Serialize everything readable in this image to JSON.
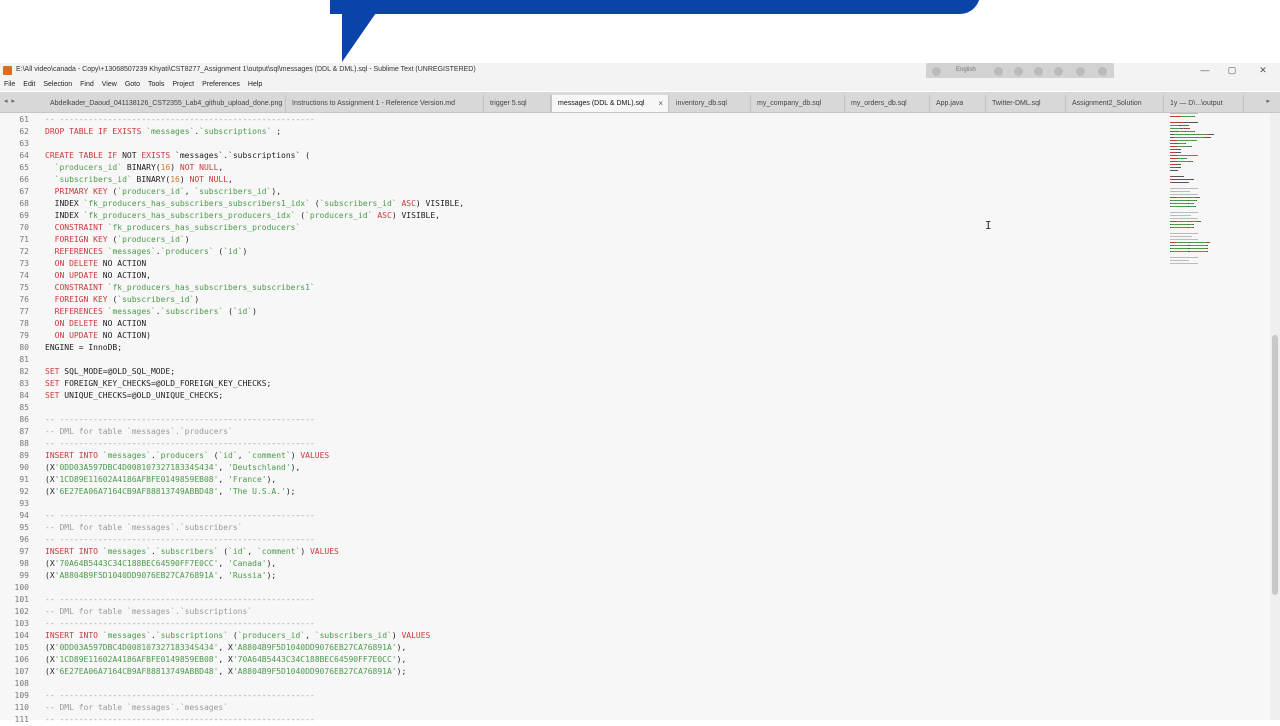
{
  "window": {
    "title": "E:\\All video\\canada - Copy\\+13068507239 Khyati\\CST8277_Assignment 1\\output\\sql\\messages (DDL & DML).sql - Sublime Text (UNREGISTERED)",
    "overlay_language": "English",
    "controls": {
      "minimize": "—",
      "maximize": "▢",
      "close": "✕"
    }
  },
  "menu": [
    "File",
    "Edit",
    "Selection",
    "Find",
    "View",
    "Goto",
    "Tools",
    "Project",
    "Preferences",
    "Help"
  ],
  "tabs": {
    "nav": "◂ ▸",
    "overflow": "▸",
    "close_glyph": "×",
    "items": [
      {
        "label": "Abdelkader_Daoud_041138126_CST2355_Lab4_github_upload_done.png",
        "active": false
      },
      {
        "label": "Instructions to Assignment 1 - Reference Version.md",
        "active": false
      },
      {
        "label": "trigger 5.sql",
        "active": false
      },
      {
        "label": "messages (DDL & DML).sql",
        "active": true
      },
      {
        "label": "inventory_db.sql",
        "active": false
      },
      {
        "label": "my_company_db.sql",
        "active": false
      },
      {
        "label": "my_orders_db.sql",
        "active": false
      },
      {
        "label": "App.java",
        "active": false
      },
      {
        "label": "Twitter-DML.sql",
        "active": false
      },
      {
        "label": "Assignment2_Solution",
        "active": false
      },
      {
        "label": "1y — D\\...\\output",
        "active": false
      }
    ]
  },
  "editor": {
    "lines": [
      {
        "n": "61",
        "t": [
          [
            "cm",
            "-- -----------------------------------------------------"
          ]
        ]
      },
      {
        "n": "62",
        "t": [
          [
            "kw",
            "DROP TABLE IF EXISTS "
          ],
          [
            "str",
            "`messages`"
          ],
          [
            "tk",
            "."
          ],
          [
            "str",
            "`subscriptions`"
          ],
          [
            "tk",
            " ;"
          ]
        ]
      },
      {
        "n": "63",
        "t": []
      },
      {
        "n": "64",
        "t": [
          [
            "kw",
            "CREATE TABLE IF "
          ],
          [
            "tk",
            "NOT "
          ],
          [
            "kw",
            "EXISTS "
          ],
          [
            "tk",
            "`messages`.`subscriptions` ("
          ]
        ]
      },
      {
        "n": "65",
        "t": [
          [
            "str",
            "  `producers_id` "
          ],
          [
            "tk",
            "BINARY("
          ],
          [
            "num",
            "16"
          ],
          [
            "tk",
            ") "
          ],
          [
            "kw",
            "NOT NULL"
          ],
          [
            "tk",
            ","
          ]
        ]
      },
      {
        "n": "66",
        "t": [
          [
            "str",
            "  `subscribers_id` "
          ],
          [
            "tk",
            "BINARY("
          ],
          [
            "num",
            "16"
          ],
          [
            "tk",
            ") "
          ],
          [
            "kw",
            "NOT NULL"
          ],
          [
            "tk",
            ","
          ]
        ]
      },
      {
        "n": "67",
        "t": [
          [
            "kw",
            "  PRIMARY KEY "
          ],
          [
            "tk",
            "("
          ],
          [
            "str",
            "`producers_id`"
          ],
          [
            "tk",
            ", "
          ],
          [
            "str",
            "`subscribers_id`"
          ],
          [
            "tk",
            "),"
          ]
        ]
      },
      {
        "n": "68",
        "t": [
          [
            "tk",
            "  INDEX "
          ],
          [
            "str",
            "`fk_producers_has_subscribers_subscribers1_idx`"
          ],
          [
            "tk",
            " ("
          ],
          [
            "str",
            "`subscribers_id`"
          ],
          [
            "tk",
            " "
          ],
          [
            "kw",
            "ASC"
          ],
          [
            "tk",
            ") VISIBLE,"
          ]
        ]
      },
      {
        "n": "69",
        "t": [
          [
            "tk",
            "  INDEX "
          ],
          [
            "str",
            "`fk_producers_has_subscribers_producers_idx`"
          ],
          [
            "tk",
            " ("
          ],
          [
            "str",
            "`producers_id`"
          ],
          [
            "tk",
            " "
          ],
          [
            "kw",
            "ASC"
          ],
          [
            "tk",
            ") VISIBLE,"
          ]
        ]
      },
      {
        "n": "70",
        "t": [
          [
            "kw",
            "  CONSTRAINT "
          ],
          [
            "str",
            "`fk_producers_has_subscribers_producers`"
          ]
        ]
      },
      {
        "n": "71",
        "t": [
          [
            "kw",
            "  FOREIGN KEY "
          ],
          [
            "tk",
            "("
          ],
          [
            "str",
            "`producers_id`"
          ],
          [
            "tk",
            ")"
          ]
        ]
      },
      {
        "n": "72",
        "t": [
          [
            "kw",
            "  REFERENCES "
          ],
          [
            "str",
            "`messages`"
          ],
          [
            "tk",
            "."
          ],
          [
            "str",
            "`producers`"
          ],
          [
            "tk",
            " ("
          ],
          [
            "str",
            "`id`"
          ],
          [
            "tk",
            ")"
          ]
        ]
      },
      {
        "n": "73",
        "t": [
          [
            "kw",
            "  ON DELETE "
          ],
          [
            "tk",
            "NO ACTION"
          ]
        ]
      },
      {
        "n": "74",
        "t": [
          [
            "kw",
            "  ON UPDATE "
          ],
          [
            "tk",
            "NO ACTION,"
          ]
        ]
      },
      {
        "n": "75",
        "t": [
          [
            "kw",
            "  CONSTRAINT "
          ],
          [
            "str",
            "`fk_producers_has_subscribers_subscribers1`"
          ]
        ]
      },
      {
        "n": "76",
        "t": [
          [
            "kw",
            "  FOREIGN KEY "
          ],
          [
            "tk",
            "("
          ],
          [
            "str",
            "`subscribers_id`"
          ],
          [
            "tk",
            ")"
          ]
        ]
      },
      {
        "n": "77",
        "t": [
          [
            "kw",
            "  REFERENCES "
          ],
          [
            "str",
            "`messages`"
          ],
          [
            "tk",
            "."
          ],
          [
            "str",
            "`subscribers`"
          ],
          [
            "tk",
            " ("
          ],
          [
            "str",
            "`id`"
          ],
          [
            "tk",
            ")"
          ]
        ]
      },
      {
        "n": "78",
        "t": [
          [
            "kw",
            "  ON DELETE "
          ],
          [
            "tk",
            "NO ACTION"
          ]
        ]
      },
      {
        "n": "79",
        "t": [
          [
            "kw",
            "  ON UPDATE "
          ],
          [
            "tk",
            "NO ACTION)"
          ]
        ]
      },
      {
        "n": "80",
        "t": [
          [
            "tk",
            "ENGINE = InnoDB;"
          ]
        ]
      },
      {
        "n": "81",
        "t": []
      },
      {
        "n": "82",
        "t": [
          [
            "kw",
            "SET "
          ],
          [
            "tk",
            "SQL_MODE=@OLD_SQL_MODE;"
          ]
        ]
      },
      {
        "n": "83",
        "t": [
          [
            "kw",
            "SET "
          ],
          [
            "tk",
            "FOREIGN_KEY_CHECKS=@OLD_FOREIGN_KEY_CHECKS;"
          ]
        ]
      },
      {
        "n": "84",
        "t": [
          [
            "kw",
            "SET "
          ],
          [
            "tk",
            "UNIQUE_CHECKS=@OLD_UNIQUE_CHECKS;"
          ]
        ]
      },
      {
        "n": "85",
        "t": []
      },
      {
        "n": "86",
        "t": [
          [
            "cm",
            "-- -----------------------------------------------------"
          ]
        ]
      },
      {
        "n": "87",
        "t": [
          [
            "cm",
            "-- DML for table `messages`.`producers`"
          ]
        ]
      },
      {
        "n": "88",
        "t": [
          [
            "cm",
            "-- -----------------------------------------------------"
          ]
        ]
      },
      {
        "n": "89",
        "t": [
          [
            "kw",
            "INSERT INTO "
          ],
          [
            "str",
            "`messages`"
          ],
          [
            "tk",
            "."
          ],
          [
            "str",
            "`producers`"
          ],
          [
            "tk",
            " ("
          ],
          [
            "str",
            "`id`"
          ],
          [
            "tk",
            ", "
          ],
          [
            "str",
            "`comment`"
          ],
          [
            "tk",
            ") "
          ],
          [
            "kw",
            "VALUES"
          ]
        ]
      },
      {
        "n": "90",
        "t": [
          [
            "tk",
            "(X"
          ],
          [
            "str",
            "'0DD03A597DBC4D00810732718334S434'"
          ],
          [
            "tk",
            ", "
          ],
          [
            "str",
            "'Deutschland'"
          ],
          [
            "tk",
            "),"
          ]
        ]
      },
      {
        "n": "91",
        "t": [
          [
            "tk",
            "(X"
          ],
          [
            "str",
            "'1CD89E11602A4186AFBFE0149859EB08'"
          ],
          [
            "tk",
            ", "
          ],
          [
            "str",
            "'France'"
          ],
          [
            "tk",
            "),"
          ]
        ]
      },
      {
        "n": "92",
        "t": [
          [
            "tk",
            "(X"
          ],
          [
            "str",
            "'6E27EA06A7164CB9AF88813749ABBD48'"
          ],
          [
            "tk",
            ", "
          ],
          [
            "str",
            "'The U.S.A.'"
          ],
          [
            "tk",
            ");"
          ]
        ]
      },
      {
        "n": "93",
        "t": []
      },
      {
        "n": "94",
        "t": [
          [
            "cm",
            "-- -----------------------------------------------------"
          ]
        ]
      },
      {
        "n": "95",
        "t": [
          [
            "cm",
            "-- DML for table `messages`.`subscribers`"
          ]
        ]
      },
      {
        "n": "96",
        "t": [
          [
            "cm",
            "-- -----------------------------------------------------"
          ]
        ]
      },
      {
        "n": "97",
        "t": [
          [
            "kw",
            "INSERT INTO "
          ],
          [
            "str",
            "`messages`"
          ],
          [
            "tk",
            "."
          ],
          [
            "str",
            "`subscribers`"
          ],
          [
            "tk",
            " ("
          ],
          [
            "str",
            "`id`"
          ],
          [
            "tk",
            ", "
          ],
          [
            "str",
            "`comment`"
          ],
          [
            "tk",
            ") "
          ],
          [
            "kw",
            "VALUES"
          ]
        ]
      },
      {
        "n": "98",
        "t": [
          [
            "tk",
            "(X"
          ],
          [
            "str",
            "'70A64B5443C34C188BEC64590FF7E0CC'"
          ],
          [
            "tk",
            ", "
          ],
          [
            "str",
            "'Canada'"
          ],
          [
            "tk",
            "),"
          ]
        ]
      },
      {
        "n": "99",
        "t": [
          [
            "tk",
            "(X"
          ],
          [
            "str",
            "'A8804B9F5D1040DD9076EB27CA76891A'"
          ],
          [
            "tk",
            ", "
          ],
          [
            "str",
            "'Russia'"
          ],
          [
            "tk",
            ");"
          ]
        ]
      },
      {
        "n": "100",
        "t": []
      },
      {
        "n": "101",
        "t": [
          [
            "cm",
            "-- -----------------------------------------------------"
          ]
        ]
      },
      {
        "n": "102",
        "t": [
          [
            "cm",
            "-- DML for table `messages`.`subscriptions`"
          ]
        ]
      },
      {
        "n": "103",
        "t": [
          [
            "cm",
            "-- -----------------------------------------------------"
          ]
        ]
      },
      {
        "n": "104",
        "t": [
          [
            "kw",
            "INSERT INTO "
          ],
          [
            "str",
            "`messages`"
          ],
          [
            "tk",
            "."
          ],
          [
            "str",
            "`subscriptions`"
          ],
          [
            "tk",
            " ("
          ],
          [
            "str",
            "`producers_id`"
          ],
          [
            "tk",
            ", "
          ],
          [
            "str",
            "`subscribers_id`"
          ],
          [
            "tk",
            ") "
          ],
          [
            "kw",
            "VALUES"
          ]
        ]
      },
      {
        "n": "105",
        "t": [
          [
            "tk",
            "(X"
          ],
          [
            "str",
            "'0DD03A597DBC4D00810732718334S434'"
          ],
          [
            "tk",
            ", X"
          ],
          [
            "str",
            "'A8804B9F5D1040DD9076EB27CA76891A'"
          ],
          [
            "tk",
            "),"
          ]
        ]
      },
      {
        "n": "106",
        "t": [
          [
            "tk",
            "(X"
          ],
          [
            "str",
            "'1CD89E11602A4186AFBFE0149859EB08'"
          ],
          [
            "tk",
            ", X"
          ],
          [
            "str",
            "'70A64B5443C34C188BEC64590FF7E0CC'"
          ],
          [
            "tk",
            "),"
          ]
        ]
      },
      {
        "n": "107",
        "t": [
          [
            "tk",
            "(X"
          ],
          [
            "str",
            "'6E27EA06A7164CB9AF88813749ABBD48'"
          ],
          [
            "tk",
            ", X"
          ],
          [
            "str",
            "'A8804B9F5D1040DD9076EB27CA76891A'"
          ],
          [
            "tk",
            ");"
          ]
        ]
      },
      {
        "n": "108",
        "t": []
      },
      {
        "n": "109",
        "t": [
          [
            "cm",
            "-- -----------------------------------------------------"
          ]
        ]
      },
      {
        "n": "110",
        "t": [
          [
            "cm",
            "-- DML for table `messages`.`messages`"
          ]
        ]
      },
      {
        "n": "111",
        "t": [
          [
            "cm",
            "-- -----------------------------------------------------"
          ]
        ]
      }
    ],
    "cursor_glyph": "I"
  },
  "colors": {
    "blue_banner": "#0b44a8",
    "keyword": "#c43b3b",
    "string": "#4c9a4c",
    "number": "#d1782e",
    "comment": "#9a9a9a",
    "text": "#1e1e1e",
    "editor_bg": "#f7f7f7"
  }
}
